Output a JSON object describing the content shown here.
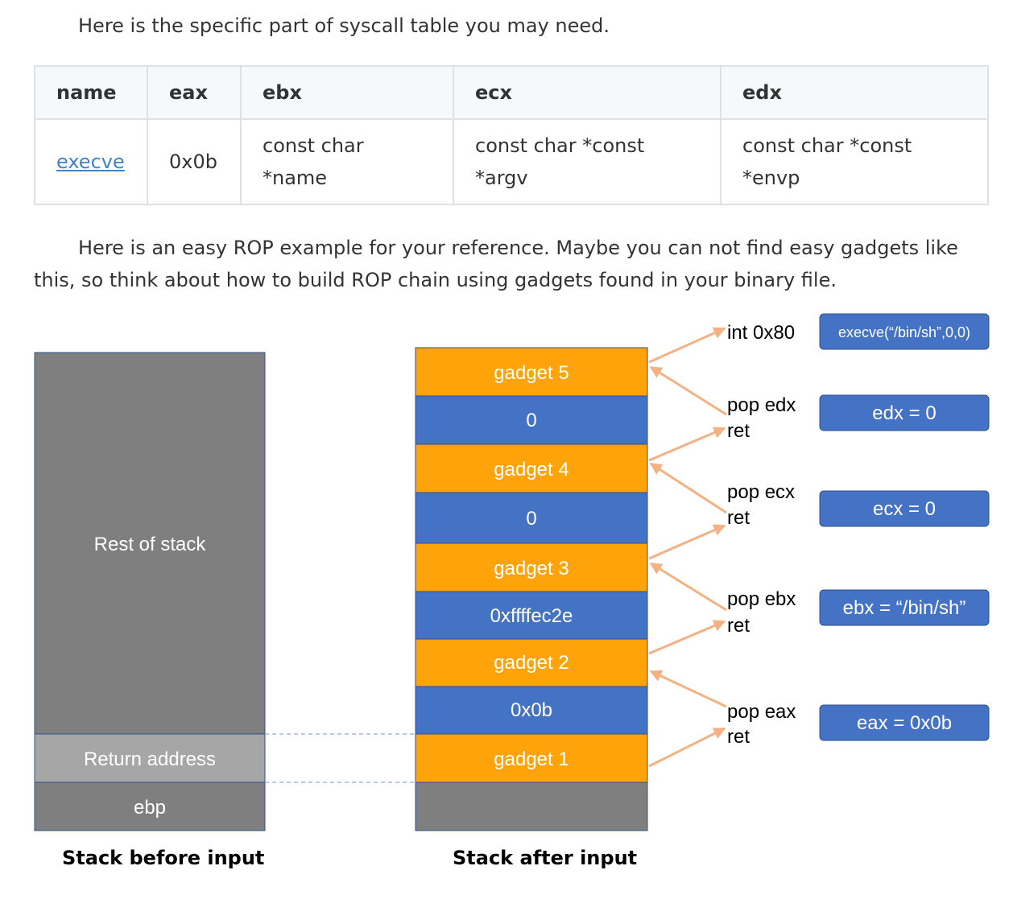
{
  "intro_text": "Here is the specific part of syscall table you may need.",
  "table": {
    "headers": [
      "name",
      "eax",
      "ebx",
      "ecx",
      "edx"
    ],
    "row": {
      "name": "execve",
      "eax": "0x0b",
      "ebx_line1": "const char",
      "ebx_line2": "*name",
      "ecx_line1": "const char *const",
      "ecx_line2": "*argv",
      "edx_line1": "const char *const",
      "edx_line2": "*envp"
    }
  },
  "rop_text": "Here is an easy ROP example for your reference. Maybe you can not find easy gadgets like this, so think about how to build ROP chain using gadgets found in your binary file.",
  "diagram": {
    "colors": {
      "orange": "#ffa30a",
      "blue": "#4472c4",
      "gray_dark": "#7f7f7f",
      "gray_light": "#a6a6a6",
      "arrow": "#f4b183"
    },
    "before_stack": {
      "rest": "Rest of stack",
      "ret": "Return address",
      "ebp": "ebp",
      "caption": "Stack before input"
    },
    "after_stack": {
      "cells": [
        "gadget 5",
        "0",
        "gadget 4",
        "0",
        "gadget 3",
        "0xffffec2e",
        "gadget 2",
        "0x0b",
        "gadget 1"
      ],
      "caption": "Stack after input"
    },
    "gadgets": {
      "g5": "int 0x80",
      "g4a": "pop edx",
      "g4b": "ret",
      "g3a": "pop ecx",
      "g3b": "ret",
      "g2a": "pop ebx",
      "g2b": "ret",
      "g1a": "pop eax",
      "g1b": "ret"
    },
    "effects": [
      "execve(“/bin/sh”,0,0)",
      "edx = 0",
      "ecx = 0",
      "ebx = “/bin/sh”",
      "eax = 0x0b"
    ]
  }
}
